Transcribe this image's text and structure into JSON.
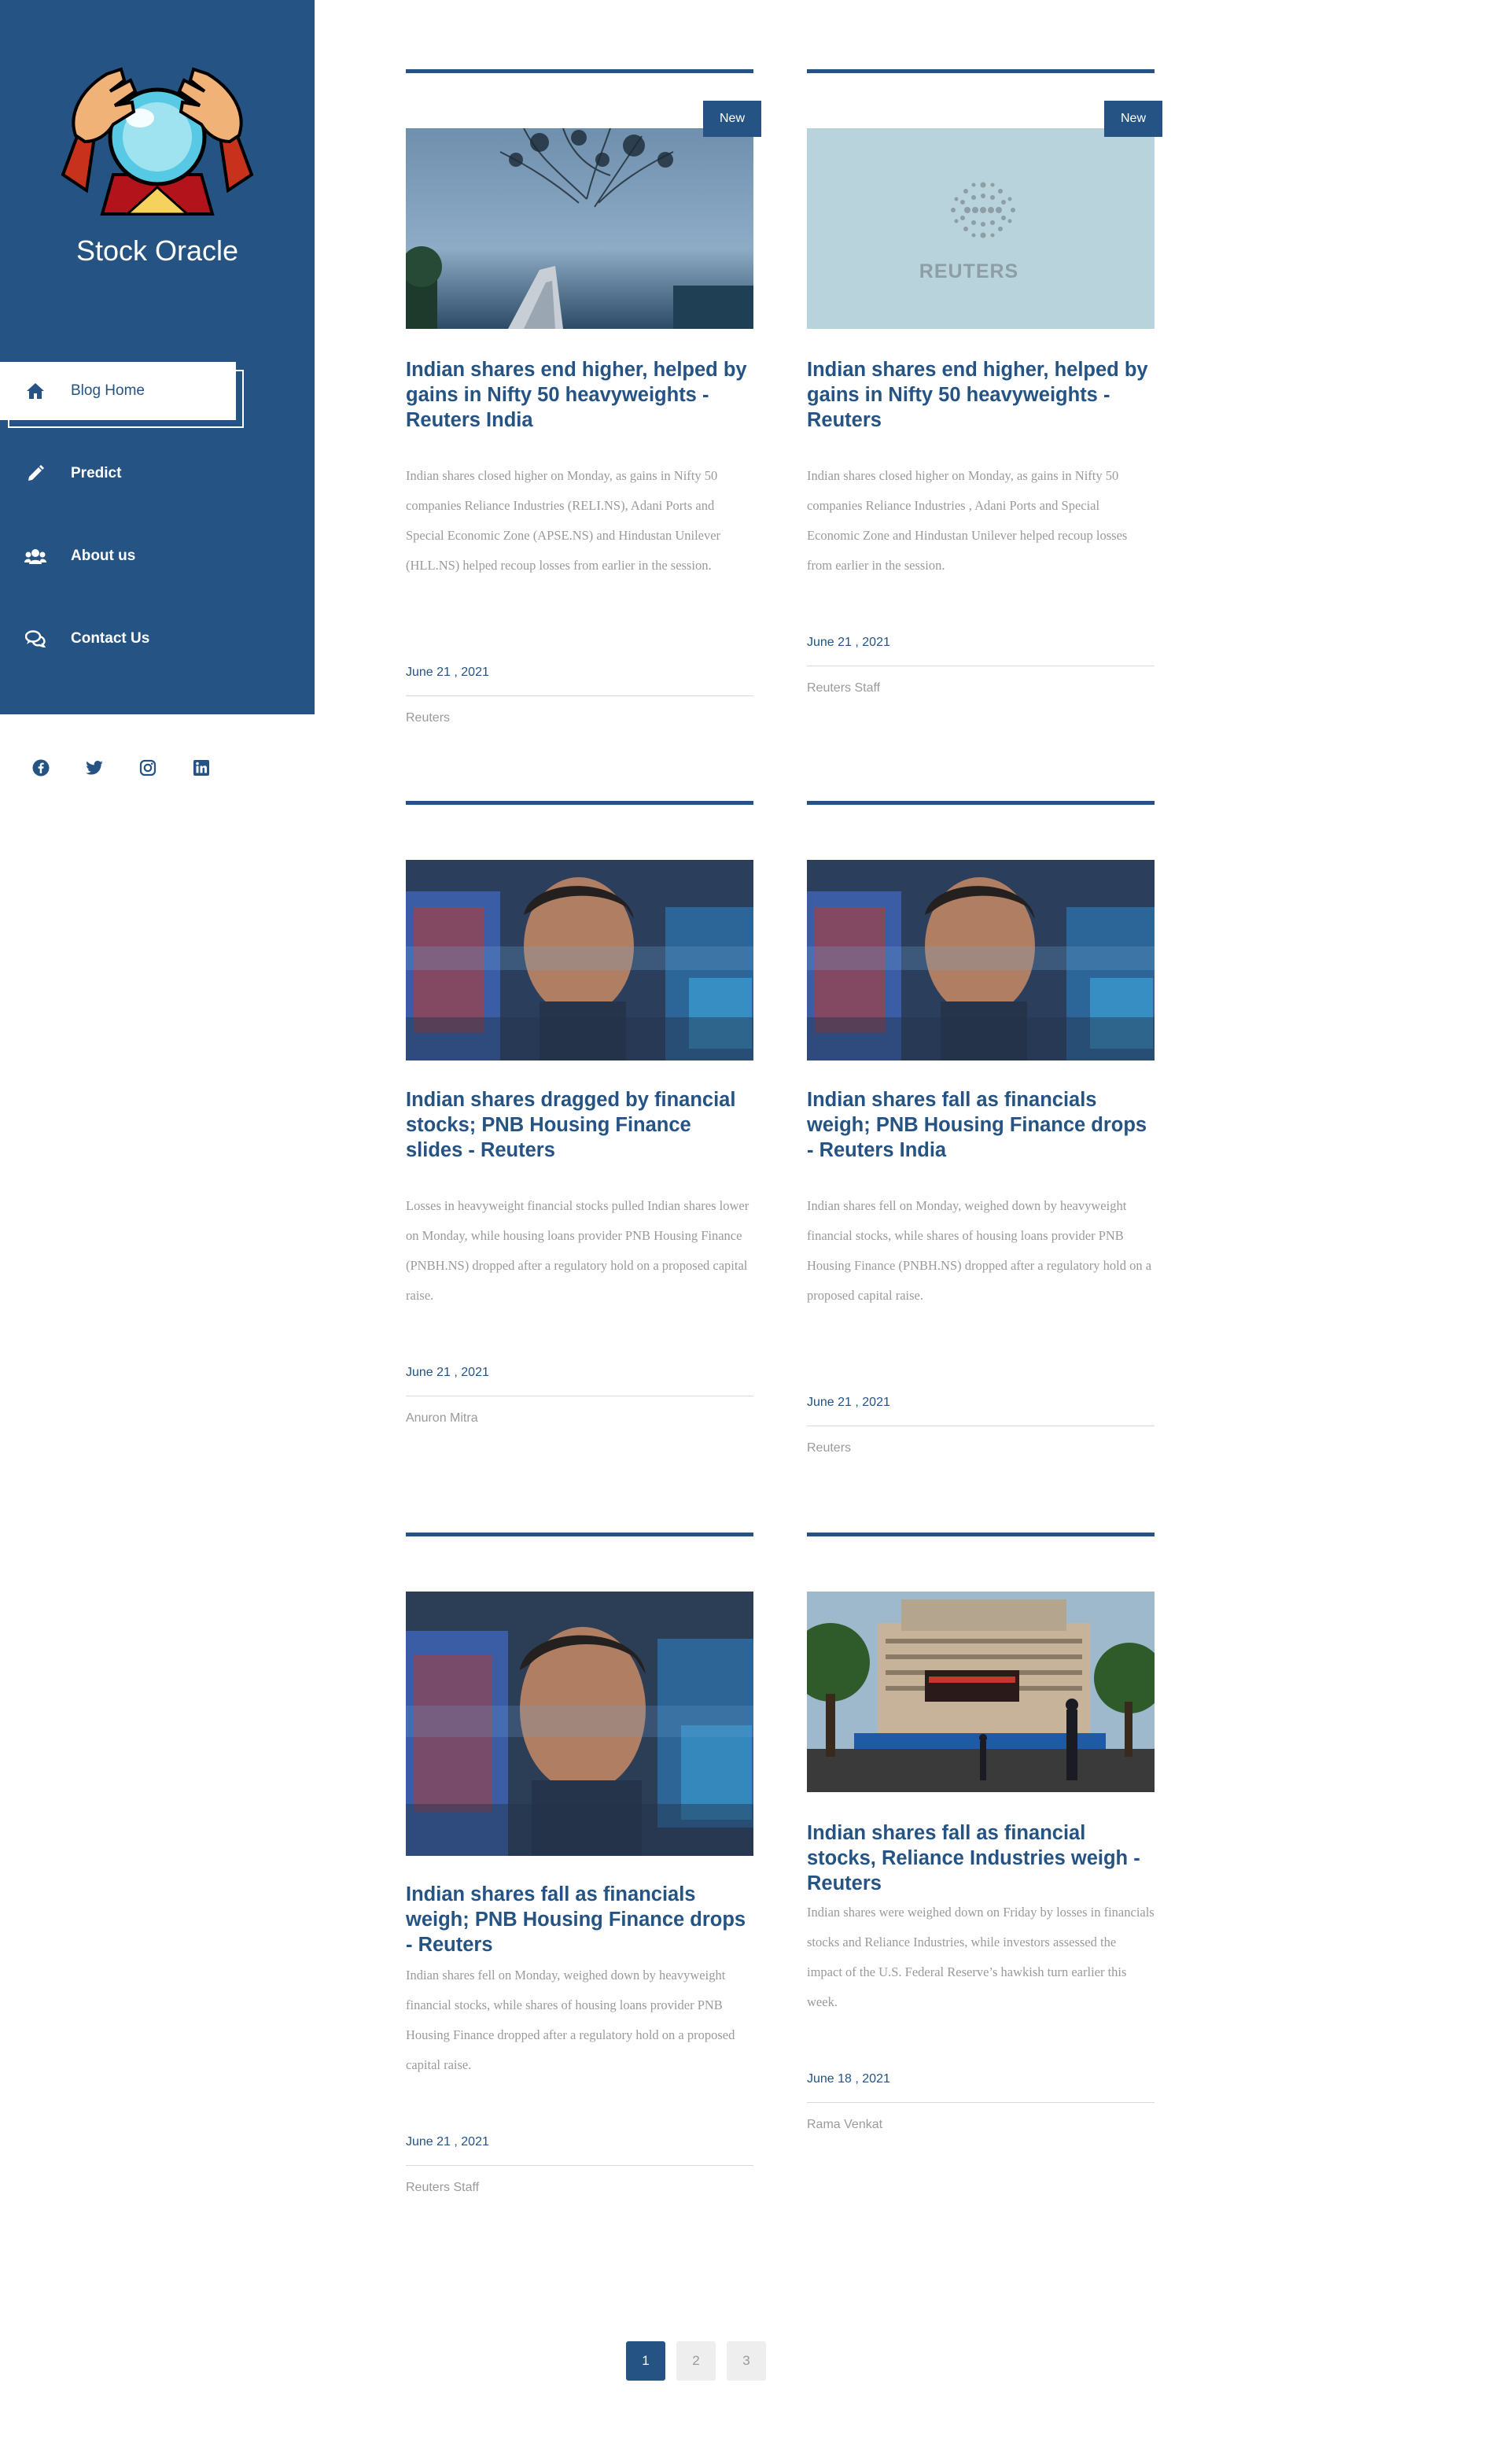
{
  "sidebar": {
    "brand": "Stock Oracle",
    "nav": [
      {
        "label": "Blog Home",
        "icon": "home-icon",
        "active": true
      },
      {
        "label": "Predict",
        "icon": "pencil-icon",
        "active": false
      },
      {
        "label": "About us",
        "icon": "users-icon",
        "active": false
      },
      {
        "label": "Contact Us",
        "icon": "chat-icon",
        "active": false
      }
    ],
    "socials": [
      "facebook-icon",
      "twitter-icon",
      "instagram-icon",
      "linkedin-icon"
    ]
  },
  "posts": [
    {
      "badge": "New",
      "image": "stock-exchange-tree-photo",
      "title": "Indian shares end higher, helped by gains in Nifty 50 heavyweights - Reuters India",
      "excerpt": "Indian shares closed higher on Monday, as gains in Nifty 50 companies Reliance Industries (RELI.NS), Adani Ports and Special Economic Zone (APSE.NS) and Hindustan Unilever (HLL.NS) helped recoup losses from earlier in the session.",
      "date": "June 21 , 2021",
      "author": "Reuters"
    },
    {
      "badge": "New",
      "image": "reuters-logo-placeholder",
      "image_text": "REUTERS",
      "title": "Indian shares end higher, helped by gains in Nifty 50 heavyweights - Reuters",
      "excerpt": "Indian shares closed higher on Monday, as gains in Nifty 50 companies Reliance Industries , Adani Ports and Special Economic Zone and Hindustan Unilever helped recoup losses from earlier in the session.",
      "date": "June 21 , 2021",
      "author": "Reuters Staff"
    },
    {
      "badge": "",
      "image": "trader-screen-photo",
      "title": "Indian shares dragged by financial stocks; PNB Housing Finance slides - Reuters",
      "excerpt": "Losses in heavyweight financial stocks pulled Indian shares lower on Monday, while housing loans provider PNB Housing Finance (PNBH.NS) dropped after a regulatory hold on a proposed capital raise.",
      "date": "June 21 , 2021",
      "author": "Anuron Mitra"
    },
    {
      "badge": "",
      "image": "trader-screen-photo",
      "title": "Indian shares fall as financials weigh; PNB Housing Finance drops - Reuters India",
      "excerpt": "Indian shares fell on Monday, weighed down by heavyweight financial stocks, while shares of housing loans provider PNB Housing Finance (PNBH.NS) dropped after a regulatory hold on a proposed capital raise.",
      "date": "June 21 , 2021",
      "author": "Reuters"
    },
    {
      "badge": "",
      "image": "trader-screen-photo",
      "title": "Indian shares fall as financials weigh; PNB Housing Finance drops - Reuters",
      "excerpt": "Indian shares fell on Monday, weighed down by heavyweight financial stocks, while shares of housing loans provider PNB Housing Finance dropped after a regulatory hold on a proposed capital raise.",
      "date": "June 21 , 2021",
      "author": "Reuters Staff"
    },
    {
      "badge": "",
      "image": "bse-building-photo",
      "title": "Indian shares fall as financial stocks, Reliance Industries weigh - Reuters",
      "excerpt": "Indian shares were weighed down on Friday by losses in financials stocks and Reliance Industries, while investors assessed the impact of the U.S. Federal Reserve’s hawkish turn earlier this week.",
      "date": "June 18 , 2021",
      "author": "Rama Venkat"
    }
  ],
  "pagination": {
    "pages": [
      "1",
      "2",
      "3"
    ],
    "current": "1"
  },
  "colors": {
    "primary": "#255383",
    "muted": "#9a9a9a"
  }
}
